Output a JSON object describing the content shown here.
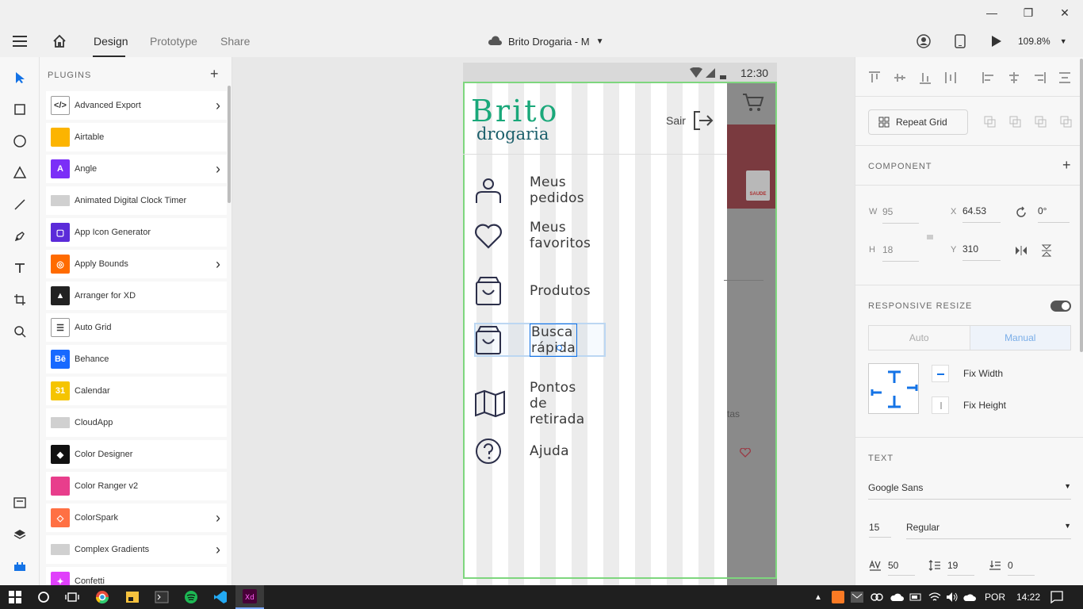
{
  "titlebar": {
    "minimize": "—",
    "restore": "❐",
    "close": "✕"
  },
  "topbar": {
    "tabs": [
      {
        "label": "Design"
      },
      {
        "label": "Prototype"
      },
      {
        "label": "Share"
      }
    ],
    "document_title": "Brito Drogaria - M",
    "zoom": "109.8%"
  },
  "plugins": {
    "title": "PLUGINS",
    "items": [
      {
        "label": "Advanced Export",
        "icon": "code-icon",
        "color": "#ffffff",
        "has_arrow": true
      },
      {
        "label": "Airtable",
        "icon": "airtable-icon",
        "color": "#fcb400",
        "has_arrow": false
      },
      {
        "label": "Angle",
        "icon": "angle-icon",
        "color": "#7b2ff7",
        "has_arrow": true
      },
      {
        "label": "Animated Digital Clock Timer",
        "icon": "folder-icon",
        "color": "#d0d0d0",
        "has_arrow": false
      },
      {
        "label": "App Icon Generator",
        "icon": "app-icon-generator-icon",
        "color": "#5b2bd9",
        "has_arrow": false
      },
      {
        "label": "Apply Bounds",
        "icon": "apply-bounds-icon",
        "color": "#ff6b00",
        "has_arrow": true
      },
      {
        "label": "Arranger for XD",
        "icon": "arranger-icon",
        "color": "#222222",
        "has_arrow": false
      },
      {
        "label": "Auto Grid",
        "icon": "auto-grid-icon",
        "color": "#ffffff",
        "has_arrow": false
      },
      {
        "label": "Behance",
        "icon": "behance-icon",
        "color": "#1769ff",
        "has_arrow": false
      },
      {
        "label": "Calendar",
        "icon": "calendar-icon",
        "color": "#f5c400",
        "has_arrow": false
      },
      {
        "label": "CloudApp",
        "icon": "folder-icon",
        "color": "#d0d0d0",
        "has_arrow": false
      },
      {
        "label": "Color Designer",
        "icon": "color-designer-icon",
        "color": "#111111",
        "has_arrow": false
      },
      {
        "label": "Color Ranger v2",
        "icon": "color-ranger-icon",
        "color": "#e83e8c",
        "has_arrow": false
      },
      {
        "label": "ColorSpark",
        "icon": "colorspark-icon",
        "color": "#ff7043",
        "has_arrow": true
      },
      {
        "label": "Complex Gradients",
        "icon": "folder-icon",
        "color": "#d0d0d0",
        "has_arrow": true
      },
      {
        "label": "Confetti",
        "icon": "confetti-icon",
        "color": "#e040fb",
        "has_arrow": false
      }
    ]
  },
  "artboard": {
    "time": "12:30",
    "logo_top": "Brito",
    "logo_bottom": "drogaria",
    "logout_label": "Sair",
    "menu": [
      {
        "label": "Meus pedidos",
        "icon": "person-icon"
      },
      {
        "label": "Meus favoritos",
        "icon": "heart-icon"
      },
      {
        "label": "Produtos",
        "icon": "shopping-bag-icon"
      },
      {
        "label": "Busca rápida",
        "icon": "shopping-bag-icon"
      },
      {
        "label": "Pontos de retirada",
        "icon": "map-icon"
      },
      {
        "label": "Ajuda",
        "icon": "help-circle-icon"
      }
    ],
    "behind_text": "tas",
    "behind_badge": "SAUDE"
  },
  "rightpanel": {
    "repeat_grid": "Repeat Grid",
    "component": "COMPONENT",
    "w_label": "W",
    "w_value": "95",
    "h_label": "H",
    "h_value": "18",
    "x_label": "X",
    "x_value": "64.53",
    "y_label": "Y",
    "y_value": "310",
    "rotation": "0°",
    "responsive": "RESPONSIVE RESIZE",
    "auto": "Auto",
    "manual": "Manual",
    "fix_width": "Fix Width",
    "fix_height": "Fix Height",
    "text": "TEXT",
    "font": "Google Sans",
    "font_size": "15",
    "font_weight": "Regular",
    "char_spacing": "50",
    "line_spacing": "19",
    "para_spacing": "0"
  },
  "taskbar": {
    "lang": "POR",
    "time": "14:22"
  },
  "colors": {
    "accent": "#1473e6",
    "logo_green": "#1aa87a",
    "logo_dark": "#1b5f6b",
    "icon_navy": "#2c2f4a",
    "selection": "#7ed67e"
  }
}
